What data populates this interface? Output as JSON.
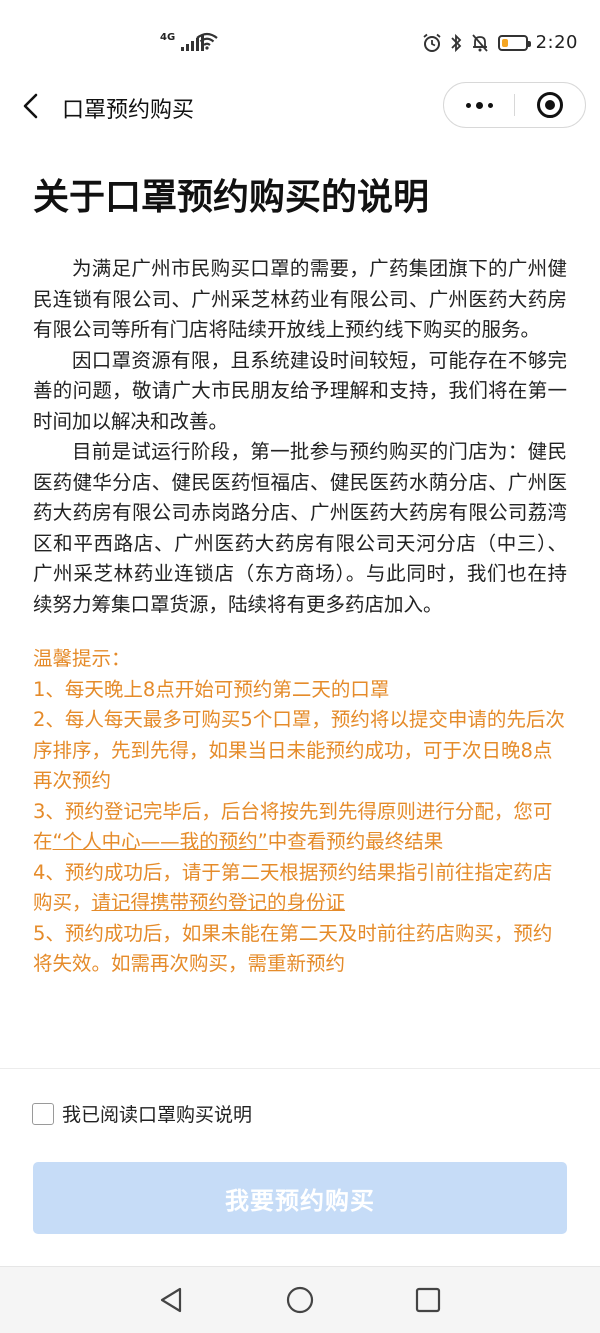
{
  "status_bar": {
    "network": "4G",
    "time": "2:20",
    "battery_level": 0.25,
    "battery_color": "#f5a623"
  },
  "nav": {
    "title": "口罩预约购买",
    "icons": [
      "back-icon",
      "more-icon",
      "close-miniprogram-icon"
    ]
  },
  "article": {
    "heading": "关于口罩预约购买的说明",
    "paragraphs": [
      "为满足广州市民购买口罩的需要，广药集团旗下的广州健民连锁有限公司、广州采芝林药业有限公司、广州医药大药房有限公司等所有门店将陆续开放线上预约线下购买的服务。",
      "因口罩资源有限，且系统建设时间较短，可能存在不够完善的问题，敬请广大市民朋友给予理解和支持，我们将在第一时间加以解决和改善。",
      "目前是试运行阶段，第一批参与预约购买的门店为：健民医药健华分店、健民医药恒福店、健民医药水荫分店、广州医药大药房有限公司赤岗路分店、广州医药大药房有限公司荔湾区和平西路店、广州医药大药房有限公司天河分店（中三）、广州采芝林药业连锁店（东方商场）。与此同时，我们也在持续努力筹集口罩货源，陆续将有更多药店加入。"
    ]
  },
  "notice": {
    "color": "#e58b2a",
    "title": "温馨提示：",
    "item1": "1、每天晚上8点开始可预约第二天的口罩",
    "item2": "2、每人每天最多可购买5个口罩，预约将以提交申请的先后次序排序，先到先得，如果当日未能预约成功，可于次日晚8点再次预约",
    "item3_pre": "3、预约登记完毕后，后台将按先到先得原则进行分配，您可在",
    "item3_link": "“个人中心——我的预约”",
    "item3_post": "中查看预约最终结果",
    "item4_pre": "4、预约成功后，请于第二天根据预约结果指引前往指定药店购买，",
    "item4_link": "请记得携带预约登记的身份证",
    "item5": "5、预约成功后，如果未能在第二天及时前往药店购买，预约将失效。如需再次购买，需重新预约"
  },
  "agreement": {
    "label": "我已阅读口罩购买说明",
    "checked": false
  },
  "submit": {
    "label": "我要预约购买",
    "color": "#c6dcf7"
  },
  "system_nav": {
    "icons": [
      "triangle-back-icon",
      "circle-home-icon",
      "square-recents-icon"
    ]
  }
}
